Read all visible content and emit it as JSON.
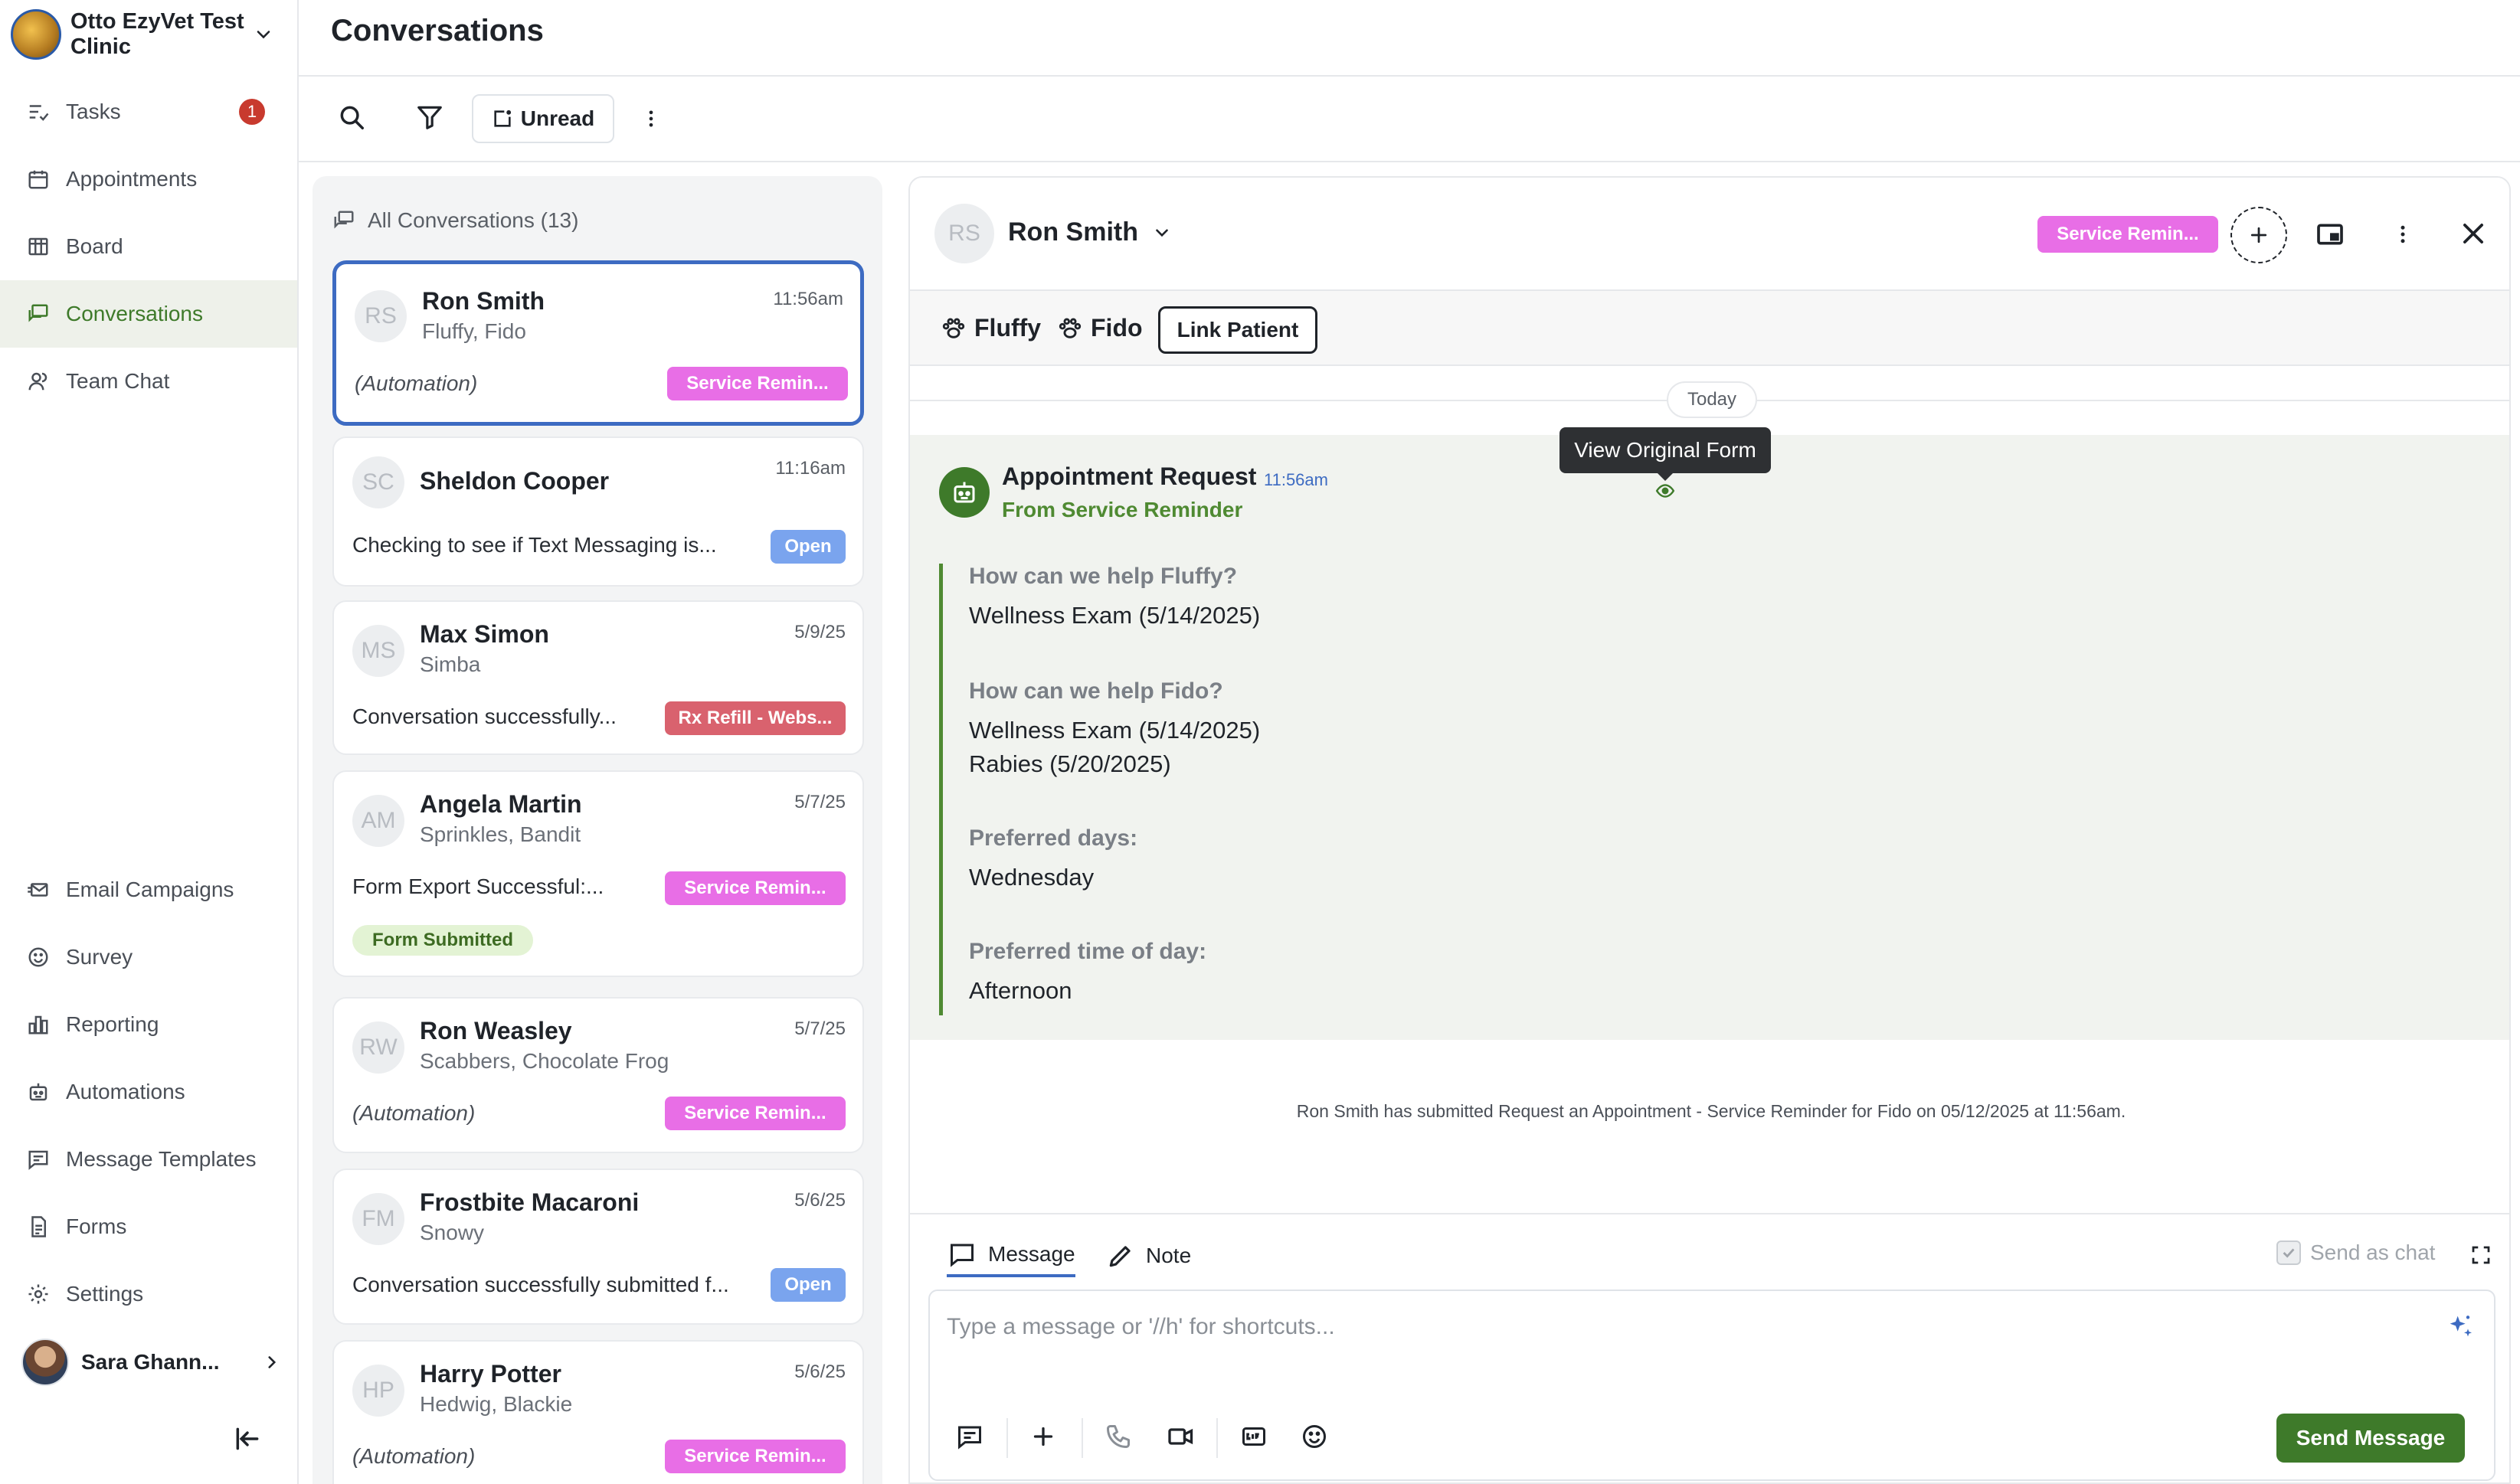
{
  "clinic": {
    "name": "Otto EzyVet Test Clinic"
  },
  "nav": {
    "top": [
      {
        "label": "Tasks",
        "badge": "1",
        "icon": "tasks-icon"
      },
      {
        "label": "Appointments",
        "icon": "calendar-icon"
      },
      {
        "label": "Board",
        "icon": "board-icon"
      },
      {
        "label": "Conversations",
        "icon": "chat-icon",
        "active": true
      },
      {
        "label": "Team Chat",
        "icon": "team-icon"
      }
    ],
    "bottom": [
      {
        "label": "Email Campaigns",
        "icon": "email-icon"
      },
      {
        "label": "Survey",
        "icon": "smiley-icon"
      },
      {
        "label": "Reporting",
        "icon": "chart-icon"
      },
      {
        "label": "Automations",
        "icon": "robot-icon"
      },
      {
        "label": "Message Templates",
        "icon": "template-icon"
      },
      {
        "label": "Forms",
        "icon": "form-icon"
      },
      {
        "label": "Settings",
        "icon": "gear-icon"
      }
    ],
    "user": "Sara Ghann..."
  },
  "header": {
    "title": "Conversations",
    "unread_label": "Unread"
  },
  "list": {
    "heading": "All Conversations (13)",
    "items": [
      {
        "initials": "RS",
        "name": "Ron Smith",
        "pets": "Fluffy, Fido",
        "time": "11:56am",
        "preview": "(Automation)",
        "tag": "Service Remin..."
      },
      {
        "initials": "SC",
        "name": "Sheldon Cooper",
        "pets": "",
        "time": "11:16am",
        "preview": "Checking to see if Text Messaging is...",
        "tag": "Open"
      },
      {
        "initials": "MS",
        "name": "Max Simon",
        "pets": "Simba",
        "time": "5/9/25",
        "preview": "Conversation successfully...",
        "tag": "Rx Refill - Webs..."
      },
      {
        "initials": "AM",
        "name": "Angela Martin",
        "pets": "Sprinkles, Bandit",
        "time": "5/7/25",
        "preview": "Form Export Successful:...",
        "tag": "Service Remin...",
        "extra": "Form Submitted"
      },
      {
        "initials": "RW",
        "name": "Ron Weasley",
        "pets": "Scabbers, Chocolate Frog",
        "time": "5/7/25",
        "preview": "(Automation)",
        "tag": "Service Remin..."
      },
      {
        "initials": "FM",
        "name": "Frostbite Macaroni",
        "pets": "Snowy",
        "time": "5/6/25",
        "preview": "Conversation successfully submitted f...",
        "tag": "Open"
      },
      {
        "initials": "HP",
        "name": "Harry Potter",
        "pets": "Hedwig, Blackie",
        "time": "5/6/25",
        "preview": "(Automation)",
        "tag": "Service Remin..."
      }
    ]
  },
  "pane": {
    "initials": "RS",
    "name": "Ron Smith",
    "tag": "Service Remin...",
    "pets": [
      "Fluffy",
      "Fido"
    ],
    "link_patient": "Link Patient",
    "date_divider": "Today",
    "message": {
      "title": "Appointment Request",
      "time": "11:56am",
      "from": "From Service Reminder",
      "tooltip": "View Original Form",
      "qa": [
        {
          "q": "How can we help Fluffy?",
          "a": [
            "Wellness Exam (5/14/2025)"
          ]
        },
        {
          "q": "How can we help Fido?",
          "a": [
            "Wellness Exam (5/14/2025)",
            "Rabies (5/20/2025)"
          ]
        },
        {
          "q": "Preferred days:",
          "a": [
            "Wednesday"
          ]
        },
        {
          "q": "Preferred time of day:",
          "a": [
            "Afternoon"
          ]
        }
      ]
    },
    "system_message": "Ron Smith has submitted Request an Appointment - Service Reminder for Fido on 05/12/2025 at 11:56am.",
    "compose": {
      "tab_message": "Message",
      "tab_note": "Note",
      "send_as_chat": "Send as chat",
      "placeholder": "Type a message or '//h' for shortcuts...",
      "send_label": "Send Message"
    }
  },
  "colors": {
    "accent_green": "#3e7a2a",
    "pink_tag": "#e86ee6",
    "blue_tag": "#7aa4ee",
    "red_tag": "#d9626e",
    "selected_border": "#3d6bc2"
  }
}
